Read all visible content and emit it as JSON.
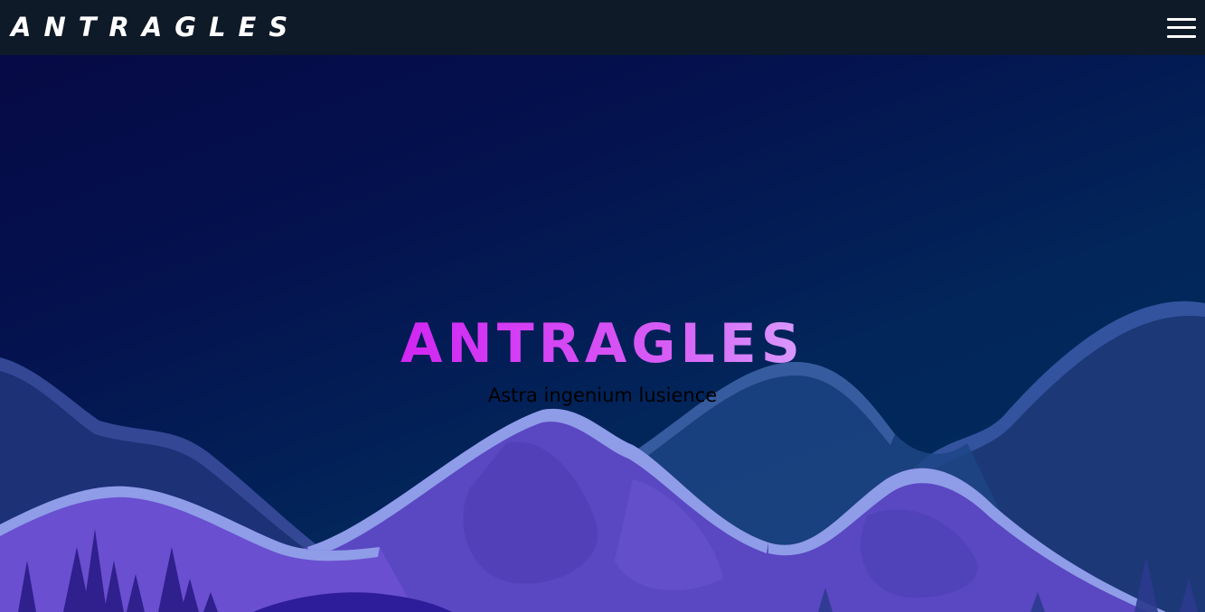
{
  "header": {
    "brand": "ANTRAGLES",
    "menu_icon": "hamburger-menu-icon"
  },
  "hero": {
    "title": "ANTRAGLES",
    "subtitle": "Astra ingenium lusience"
  },
  "colors": {
    "topbar": "#0f1a28",
    "sky_top": "#060a45",
    "sky_bottom": "#03305e",
    "mountain_front": "#6a4fd0",
    "mountain_highlight": "#8f9ce8",
    "title_gradient": [
      "#e861b0",
      "#d01ef2",
      "#d8b7ff"
    ]
  }
}
